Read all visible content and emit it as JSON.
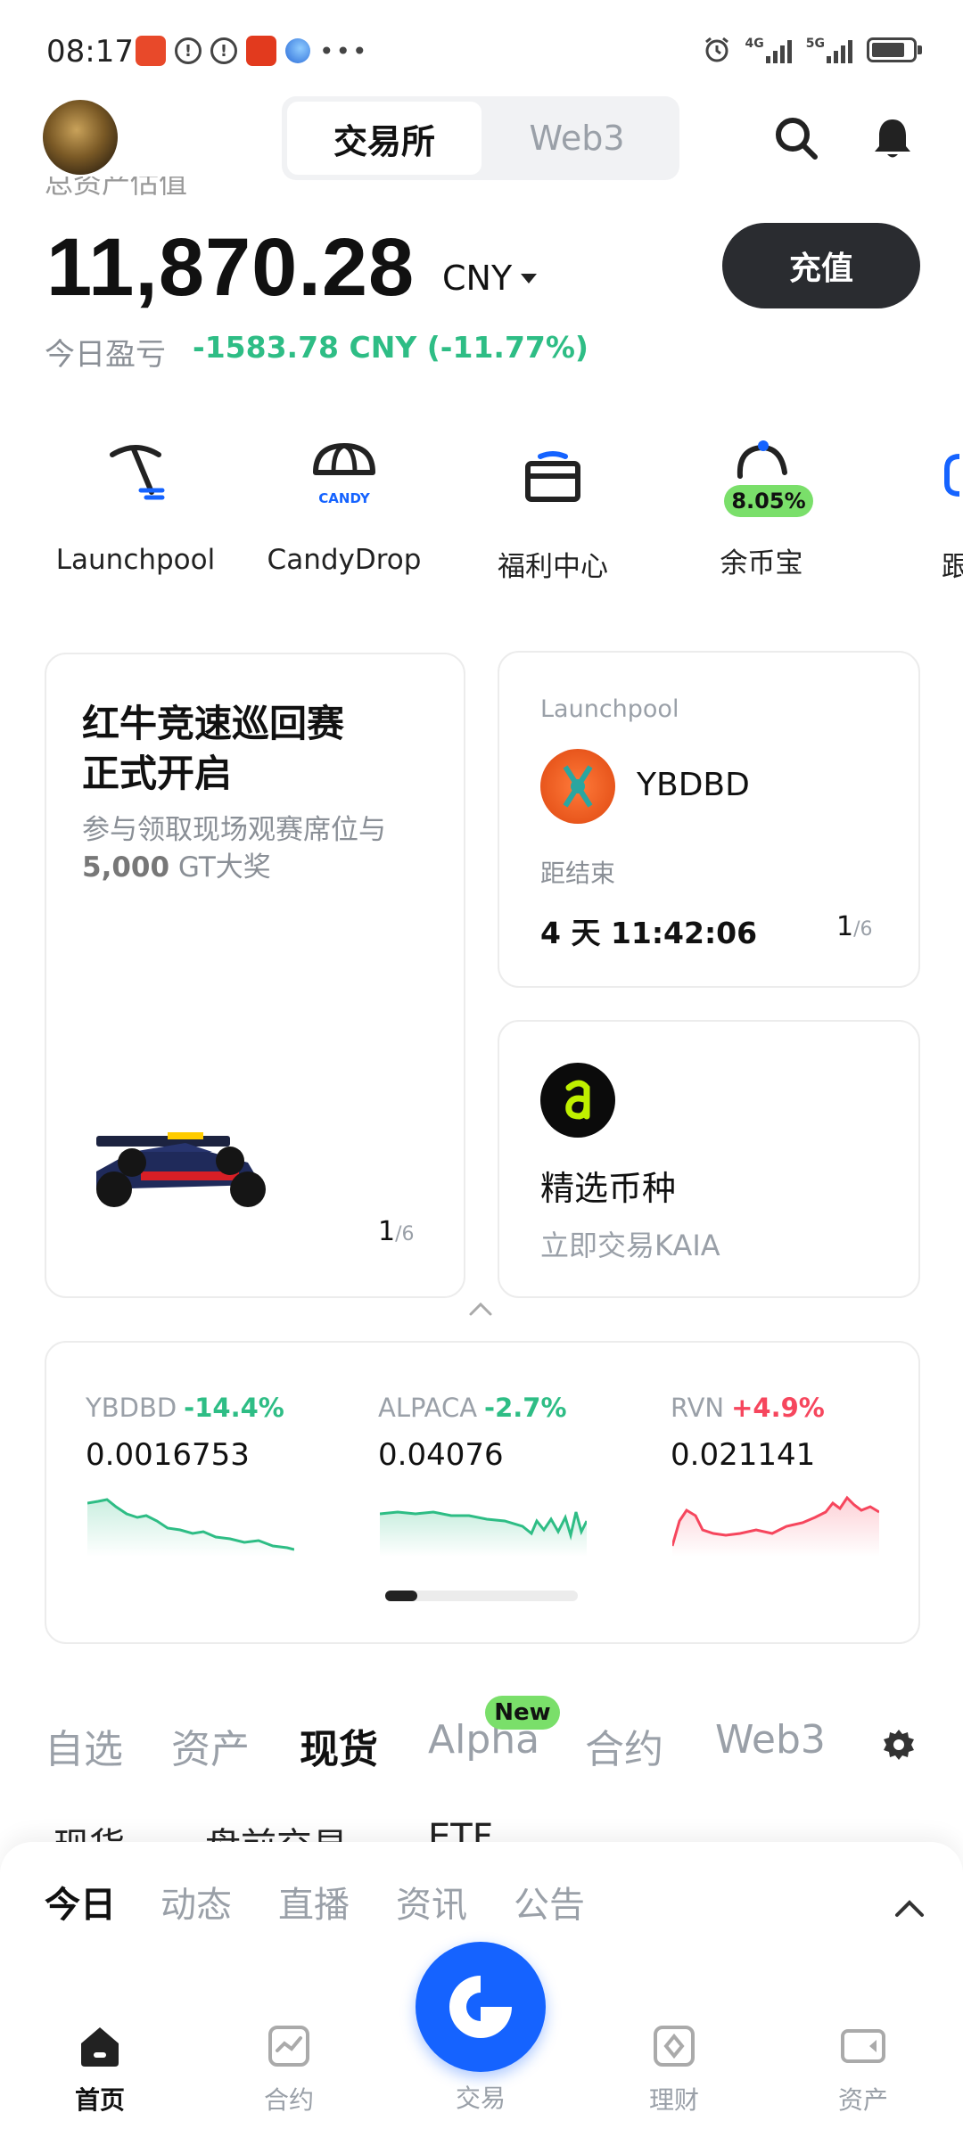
{
  "status_bar": {
    "time": "08:17",
    "network1": "4G",
    "network2": "5G"
  },
  "header": {
    "tabs": [
      {
        "label": "交易所",
        "active": true
      },
      {
        "label": "Web3",
        "active": false
      }
    ],
    "icons": [
      "search-icon",
      "bell-icon"
    ]
  },
  "balance": {
    "label_partial": "总资产估值",
    "amount": "11,870.28",
    "currency": "CNY",
    "deposit_label": "充值",
    "pnl_label": "今日盈亏",
    "pnl_value": "-1583.78 CNY (-11.77%)"
  },
  "quick_actions": [
    {
      "label": "Launchpool",
      "icon": "pickaxe-icon"
    },
    {
      "label": "CandyDrop",
      "icon": "parachute-icon"
    },
    {
      "label": "福利中心",
      "icon": "gift-icon"
    },
    {
      "label": "余币宝",
      "icon": "piggy-icon",
      "badge": "8.05%"
    },
    {
      "label": "跟",
      "icon": "copy-icon"
    }
  ],
  "promo_card": {
    "title": "红牛竞速巡回赛\n正式开启",
    "subtitle_line1": "参与领取现场观赛席位与",
    "subtitle_bold": "5,000",
    "subtitle_rest": " GT大奖",
    "pager_current": "1",
    "pager_total": "/6"
  },
  "launchpool_card": {
    "label": "Launchpool",
    "token": "YBDBD",
    "ends_label": "距结束",
    "countdown": "4 天 11:42:06",
    "pager_current": "1",
    "pager_total": "/6"
  },
  "featured_card": {
    "title": "精选币种",
    "subtitle": "立即交易KAIA"
  },
  "tickers": [
    {
      "symbol": "YBDBD",
      "change": "-14.4%",
      "price": "0.0016753",
      "color": "#2ebd85"
    },
    {
      "symbol": "ALPACA",
      "change": "-2.7%",
      "price": "0.04076",
      "color": "#2ebd85"
    },
    {
      "symbol": "RVN",
      "change": "+4.9%",
      "price": "0.021141",
      "color": "#f6465d"
    }
  ],
  "market_tabs": [
    {
      "label": "自选",
      "active": false
    },
    {
      "label": "资产",
      "active": false
    },
    {
      "label": "现货",
      "active": true
    },
    {
      "label": "Alpha",
      "active": false,
      "badge": "New"
    },
    {
      "label": "合约",
      "active": false
    },
    {
      "label": "Web3",
      "active": false
    }
  ],
  "sub_tabs_partial": [
    "现货",
    "盘前交易",
    "ETF"
  ],
  "news_tabs": [
    {
      "label": "今日",
      "active": true
    },
    {
      "label": "动态",
      "active": false
    },
    {
      "label": "直播",
      "active": false
    },
    {
      "label": "资讯",
      "active": false
    },
    {
      "label": "公告",
      "active": false
    }
  ],
  "bottom_nav": [
    {
      "label": "首页",
      "active": true
    },
    {
      "label": "合约",
      "active": false
    },
    {
      "label": "交易",
      "active": false
    },
    {
      "label": "理财",
      "active": false
    },
    {
      "label": "资产",
      "active": false
    }
  ],
  "colors": {
    "accent_blue": "#1563ff",
    "up_green": "#2ebd85",
    "down_red": "#f6465d",
    "badge_green": "#7adf6a"
  }
}
